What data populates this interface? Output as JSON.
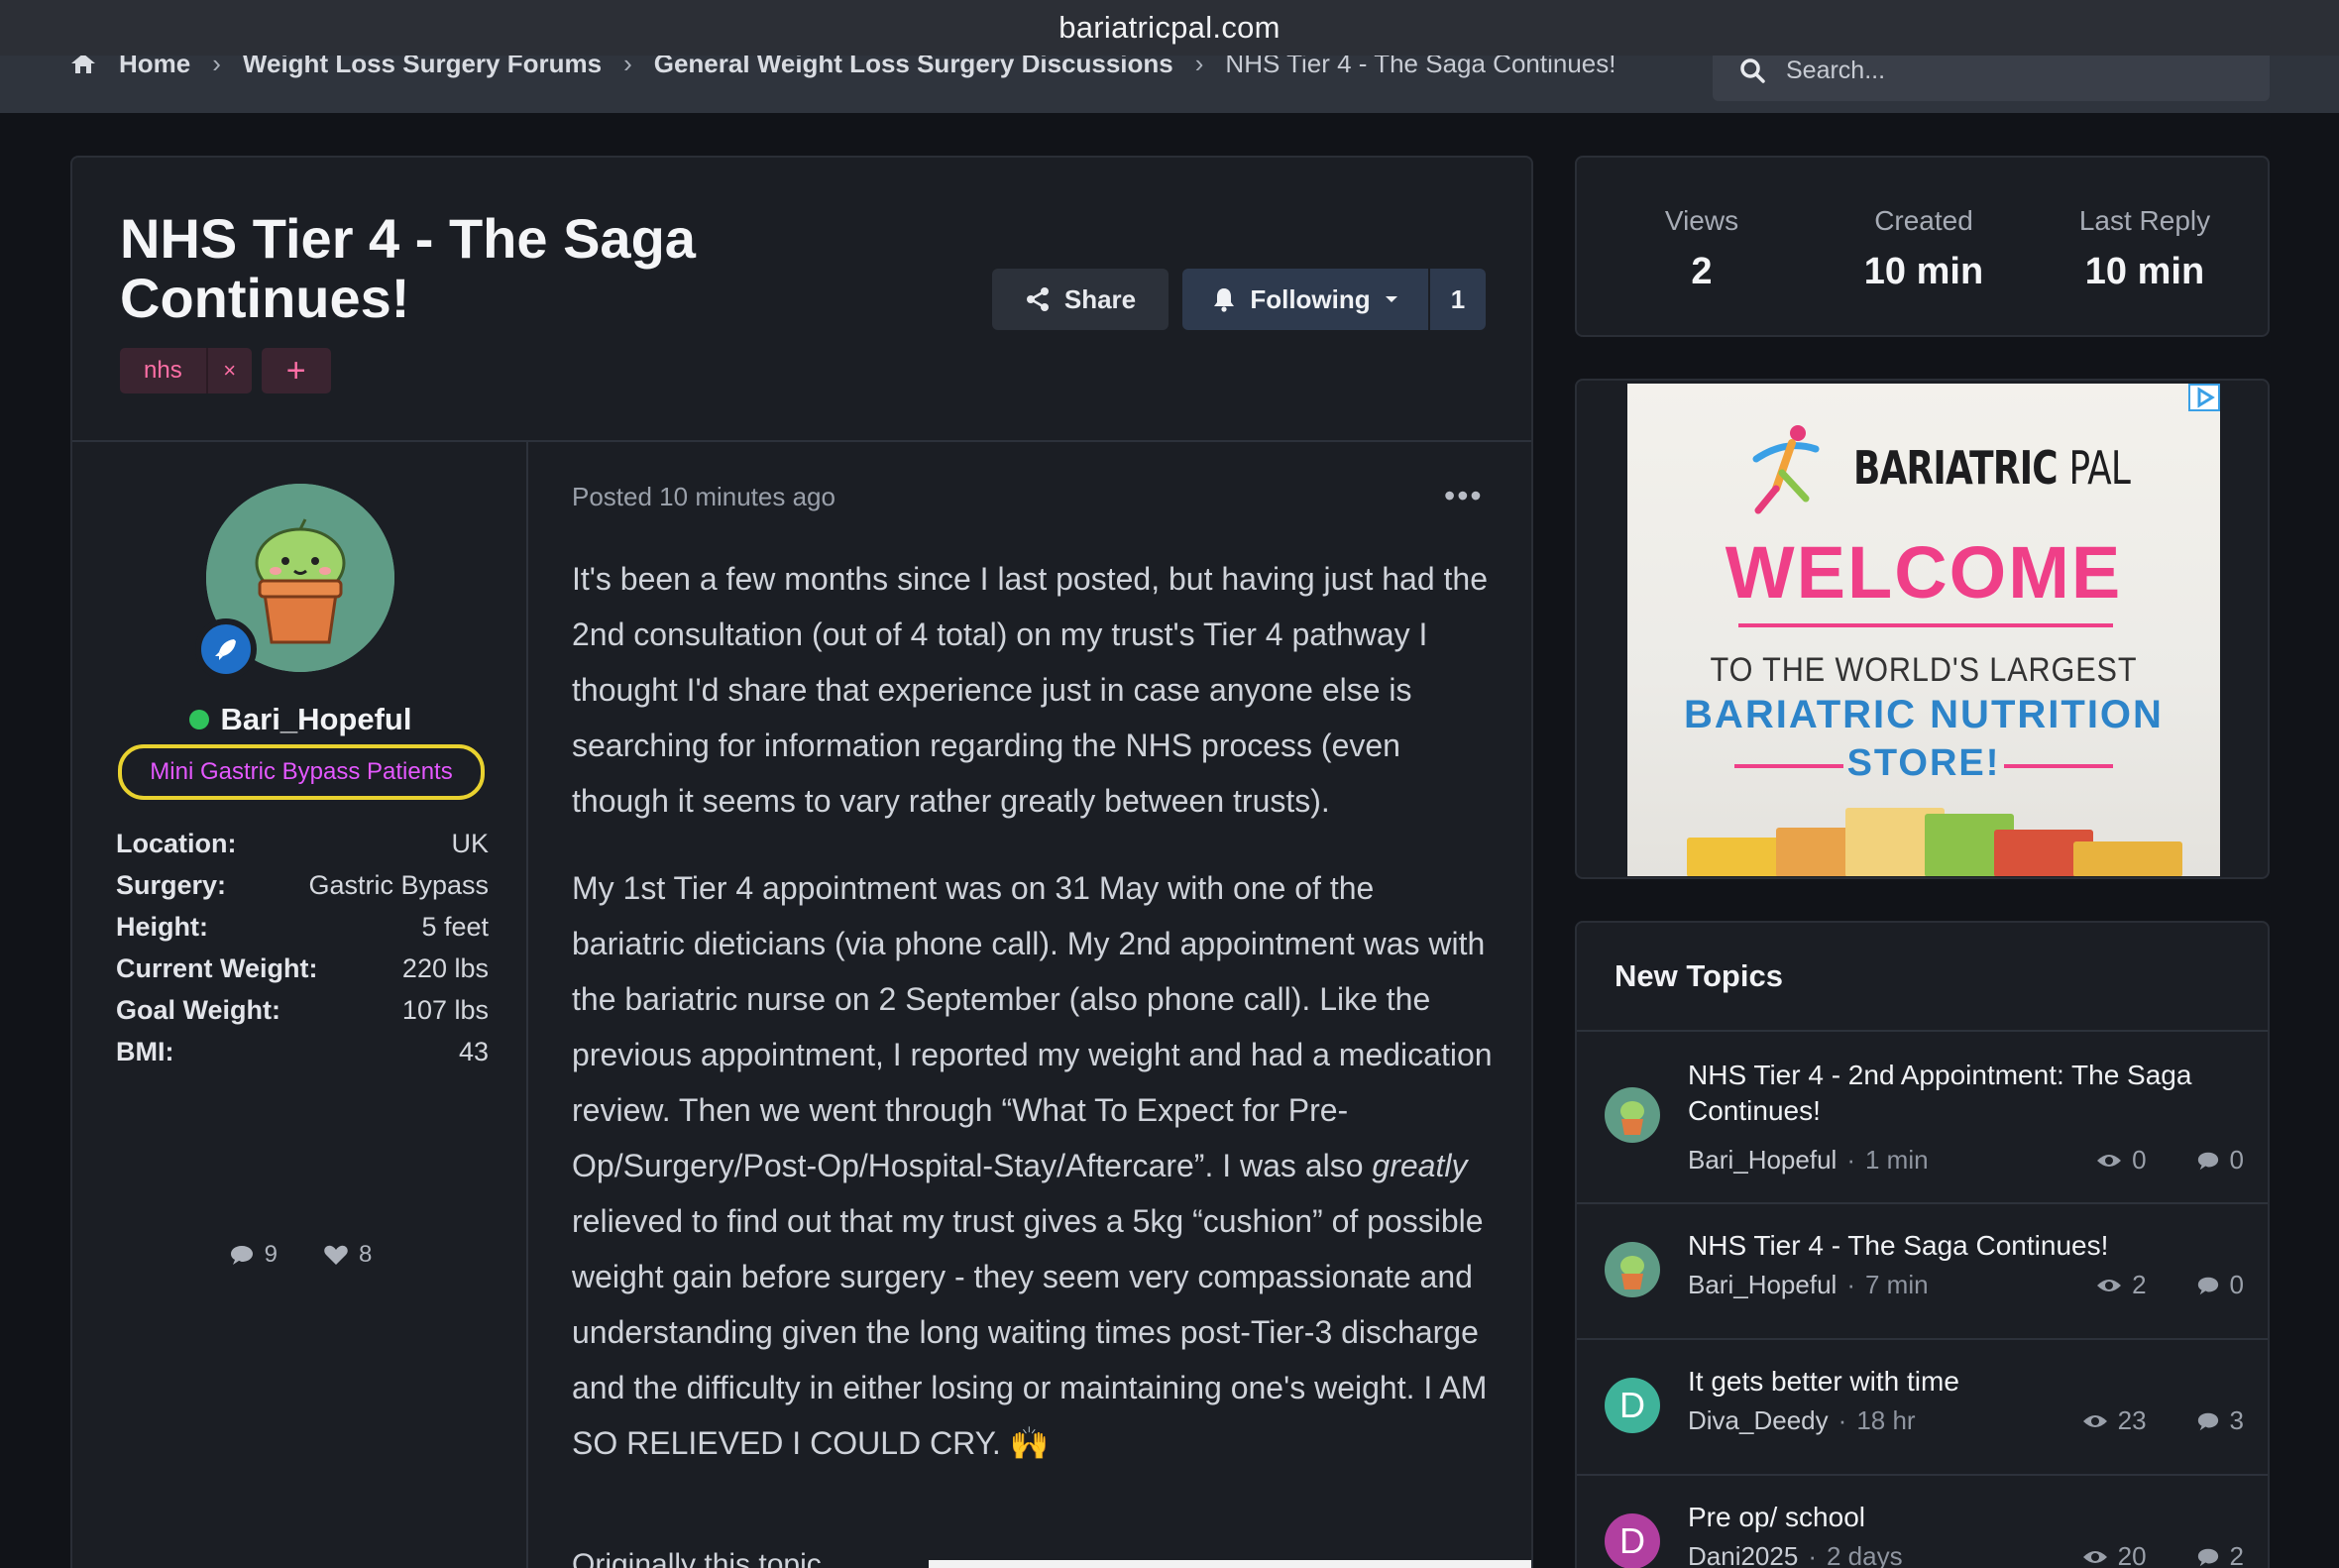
{
  "browser": {
    "url": "bariatricpal.com"
  },
  "breadcrumb": {
    "items": [
      "Home",
      "Weight Loss Surgery Forums",
      "General Weight Loss Surgery Discussions",
      "NHS Tier 4 - The Saga Continues!"
    ]
  },
  "search": {
    "placeholder": "Search..."
  },
  "topic": {
    "title": "NHS Tier 4 - The Saga Continues!",
    "tags": [
      "nhs"
    ],
    "tag_remove": "×",
    "tag_add": "+",
    "share_label": "Share",
    "following_label": "Following",
    "following_count": "1"
  },
  "author": {
    "name": "Bari_Hopeful",
    "group": "Mini Gastric Bypass Patients",
    "fields": [
      {
        "key": "Location:",
        "value": "UK"
      },
      {
        "key": "Surgery:",
        "value": "Gastric Bypass"
      },
      {
        "key": "Height:",
        "value": "5 feet"
      },
      {
        "key": "Current Weight:",
        "value": "220 lbs"
      },
      {
        "key": "Goal Weight:",
        "value": "107 lbs"
      },
      {
        "key": "BMI:",
        "value": "43"
      }
    ],
    "posts_count": "9",
    "likes_count": "8"
  },
  "post": {
    "posted": "Posted 10 minutes ago",
    "more": "•••",
    "paragraph1": "It's been a few months since I last posted, but having just had the 2nd consultation (out of 4 total) on my trust's Tier 4 pathway I thought I'd share that experience just in case anyone else is searching for information regarding the NHS process (even though it seems to vary rather greatly between trusts).",
    "paragraph2_a": "My 1st Tier 4 appointment was on 31 May with one of the bariatric dieticians (via phone call). My 2nd appointment was with the bariatric nurse on 2 September (also phone call). Like the previous appointment, I reported my weight and had a medication review. Then we went through “What To Expect for Pre-Op/Surgery/Post-Op/Hospital-Stay/Aftercare”. I was also ",
    "paragraph2_em": "greatly",
    "paragraph2_b": " relieved to find out that my trust gives a 5kg “cushion” of possible weight gain before surgery - they seem very compassionate and understanding given the long waiting times post-Tier-3 discharge and the difficulty in either losing or maintaining one's weight. I AM SO RELIEVED I COULD CRY. 🙌",
    "cut_line": "Originally this topic"
  },
  "stats": {
    "views_label": "Views",
    "views_value": "2",
    "created_label": "Created",
    "created_value": "10 min",
    "last_reply_label": "Last Reply",
    "last_reply_value": "10 min"
  },
  "ad": {
    "brand_a": "BARIATRIC",
    "brand_b": "PAL",
    "welcome": "WELCOME",
    "line1": "TO THE WORLD'S LARGEST",
    "line2": "BARIATRIC NUTRITION",
    "line3": "STORE!"
  },
  "new_topics": {
    "heading": "New Topics",
    "items": [
      {
        "title": "NHS Tier 4 - 2nd Appointment: The Saga Continues!",
        "author": "Bari_Hopeful",
        "time": "1 min",
        "views": "0",
        "replies": "0",
        "avatar": "cactus"
      },
      {
        "title": "NHS Tier 4 - The Saga Continues!",
        "author": "Bari_Hopeful",
        "time": "7 min",
        "views": "2",
        "replies": "0",
        "avatar": "cactus"
      },
      {
        "title": "It gets better with time",
        "author": "Diva_Deedy",
        "time": "18 hr",
        "views": "23",
        "replies": "3",
        "avatar": "D",
        "avatar_color": "#3fb39a"
      },
      {
        "title": "Pre op/ school",
        "author": "Dani2025",
        "time": "2 days",
        "views": "20",
        "replies": "2",
        "avatar": "D",
        "avatar_color": "#b13fa0"
      }
    ]
  },
  "colors": {
    "accent_pink": "#ef3f88",
    "group_color": "#e458ff",
    "online": "#2fc25b",
    "highlight_ring": "#e9d22f"
  }
}
